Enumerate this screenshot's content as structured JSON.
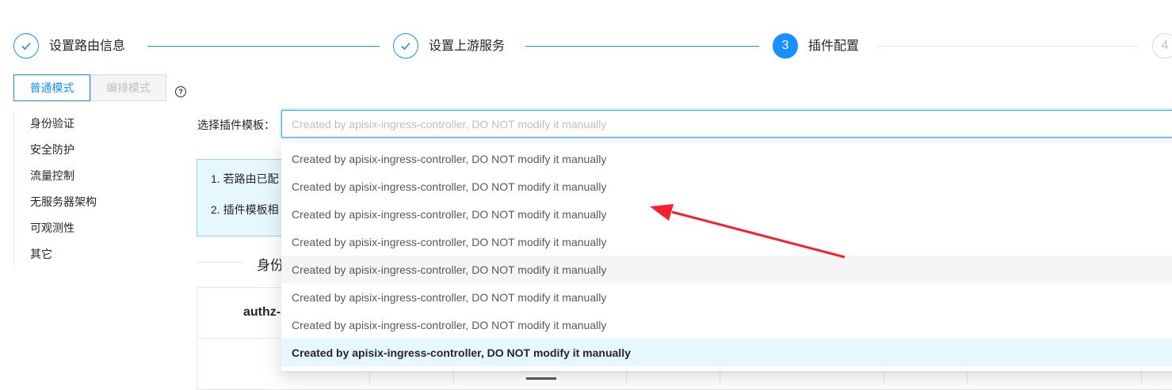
{
  "steps": [
    {
      "number": "1",
      "title": "设置路由信息",
      "status": "finish"
    },
    {
      "number": "2",
      "title": "设置上游服务",
      "status": "finish"
    },
    {
      "number": "3",
      "title": "插件配置",
      "status": "process"
    },
    {
      "number": "4",
      "title": "",
      "status": "wait"
    }
  ],
  "mode": {
    "normal_label": "普通模式",
    "orchestration_label": "编排模式",
    "selected": "普通模式"
  },
  "help_icon_glyph": "?",
  "categories": [
    "身份验证",
    "安全防护",
    "流量控制",
    "无服务器架构",
    "可观测性",
    "其它"
  ],
  "template_select": {
    "label": "选择插件模板：",
    "placeholder": "Created by apisix-ingress-controller, DO NOT modify it manually",
    "options": [
      "Created by apisix-ingress-controller, DO NOT modify it manually",
      "Created by apisix-ingress-controller, DO NOT modify it manually",
      "Created by apisix-ingress-controller, DO NOT modify it manually",
      "Created by apisix-ingress-controller, DO NOT modify it manually",
      "Created by apisix-ingress-controller, DO NOT modify it manually",
      "Created by apisix-ingress-controller, DO NOT modify it manually",
      "Created by apisix-ingress-controller, DO NOT modify it manually",
      "Created by apisix-ingress-controller, DO NOT modify it manually"
    ],
    "hovered_index": 4,
    "selected_index": 7
  },
  "alert": {
    "line1": "1. 若路由已配",
    "line2": "2. 插件模板相"
  },
  "section_title": "身份",
  "plugin_card_title": "authz-",
  "colors": {
    "primary": "#1890ff",
    "annotation_arrow": "#f5222d",
    "alert_bg": "#e6f7ff"
  }
}
